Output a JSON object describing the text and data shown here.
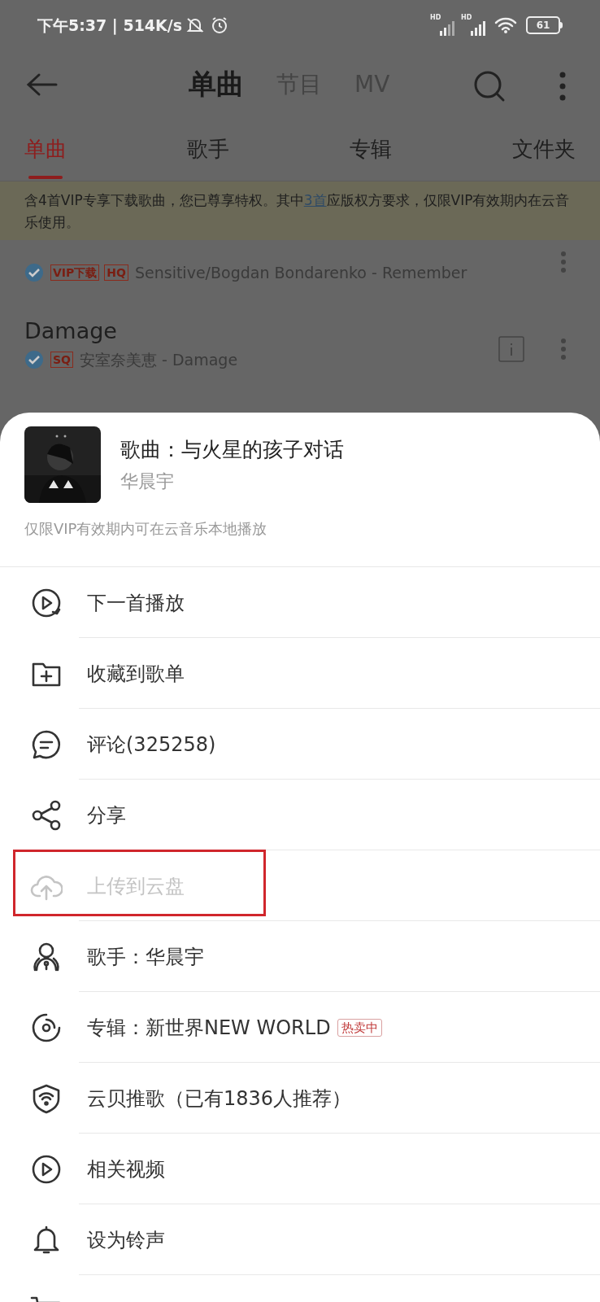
{
  "status_bar": {
    "time": "下午5:37 | 514K/s",
    "battery": "61",
    "signal_labels": [
      "HD",
      "HD"
    ]
  },
  "nav": {
    "tabs": [
      {
        "label": "单曲",
        "selected": true
      },
      {
        "label": "节目",
        "selected": false
      },
      {
        "label": "MV",
        "selected": false
      }
    ]
  },
  "sub_tabs": [
    {
      "label": "单曲",
      "selected": true
    },
    {
      "label": "歌手",
      "selected": false
    },
    {
      "label": "专辑",
      "selected": false
    },
    {
      "label": "文件夹",
      "selected": false
    }
  ],
  "notice": {
    "before": "含4首VIP专享下载歌曲，您已尊享特权。其中",
    "link": "3首",
    "after": "应版权方要求，仅限VIP有效期内在云音乐使用。"
  },
  "songs": [
    {
      "downloaded": true,
      "badges": [
        "VIP下载",
        "HQ"
      ],
      "subtitle": "Sensitive/Bogdan Bondarenko - Remember",
      "info": false
    },
    {
      "title": "Damage",
      "downloaded": true,
      "badges": [
        "SQ"
      ],
      "subtitle": "安室奈美恵 - Damage",
      "info": true
    }
  ],
  "sheet": {
    "song_title": "歌曲：与火星的孩子对话",
    "artist": "华晨宇",
    "note": "仅限VIP有效期内可在云音乐本地播放",
    "items": [
      {
        "kind": "play-next",
        "label": "下一首播放",
        "disabled": false
      },
      {
        "kind": "add-folder",
        "label": "收藏到歌单",
        "disabled": false
      },
      {
        "kind": "comment",
        "label": "评论(325258)",
        "disabled": false
      },
      {
        "kind": "share",
        "label": "分享",
        "disabled": false
      },
      {
        "kind": "cloud-upload",
        "label": "上传到云盘",
        "disabled": true,
        "highlighted": true
      },
      {
        "kind": "singer",
        "label": "歌手：华晨宇",
        "disabled": false
      },
      {
        "kind": "disc",
        "label": "专辑：新世界NEW WORLD",
        "badge": "热卖中",
        "disabled": false
      },
      {
        "kind": "shield",
        "label": "云贝推歌（已有1836人推荐）",
        "disabled": false
      },
      {
        "kind": "video",
        "label": "相关视频",
        "disabled": false
      },
      {
        "kind": "bell",
        "label": "设为铃声",
        "disabled": false
      },
      {
        "kind": "cart"
      }
    ]
  }
}
